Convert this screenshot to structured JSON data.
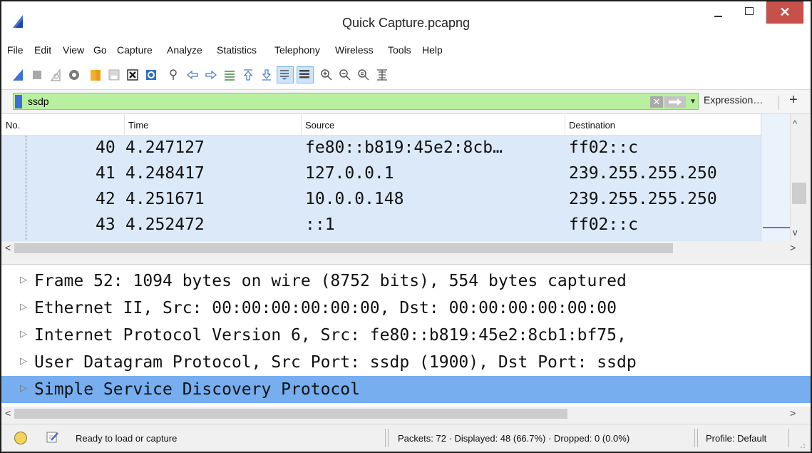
{
  "window": {
    "title": "Quick Capture.pcapng",
    "close_glyph": "✕"
  },
  "menu": [
    "File",
    "Edit",
    "View",
    "Go",
    "Capture",
    "Analyze",
    "Statistics",
    "Telephony",
    "Wireless",
    "Tools",
    "Help"
  ],
  "toolbar": {
    "icons": [
      "shark-fin-start-icon",
      "stop-icon",
      "restart-icon",
      "capture-options-icon",
      "open-file-icon",
      "save-file-icon",
      "close-file-icon",
      "reload-icon",
      "find-packet-icon",
      "go-back-icon",
      "go-forward-icon",
      "go-to-packet-icon",
      "go-first-icon",
      "go-last-icon",
      "autoscroll-icon",
      "colorize-icon",
      "zoom-in-icon",
      "zoom-out-icon",
      "zoom-normal-icon",
      "resize-columns-icon"
    ]
  },
  "filter": {
    "value": "ssdp",
    "clear_glyph": "✕",
    "dropdown_glyph": "▼",
    "expression_label": "Expression…",
    "add_label": "+",
    "color": "#b9f0a0"
  },
  "packet_list": {
    "columns": [
      "No.",
      "Time",
      "Source",
      "Destination"
    ],
    "rows": [
      {
        "no": "40",
        "time": "4.247127",
        "source": "fe80::b819:45e2:8cb…",
        "destination": "ff02::c"
      },
      {
        "no": "41",
        "time": "4.248417",
        "source": "127.0.0.1",
        "destination": "239.255.255.250"
      },
      {
        "no": "42",
        "time": "4.251671",
        "source": "10.0.0.148",
        "destination": "239.255.255.250"
      },
      {
        "no": "43",
        "time": "4.252472",
        "source": "::1",
        "destination": "ff02::c"
      }
    ],
    "row_color": "#dbe9f8",
    "scroll_up": "^",
    "scroll_down": "v",
    "scroll_left": "<",
    "scroll_right": ">"
  },
  "packet_details": {
    "expander": "▷",
    "rows": [
      "Frame 52: 1094 bytes on wire (8752 bits), 554 bytes captured",
      "Ethernet II, Src: 00:00:00:00:00:00, Dst: 00:00:00:00:00:00",
      "Internet Protocol Version 6, Src: fe80::b819:45e2:8cb1:bf75,",
      "User Datagram Protocol, Src Port: ssdp (1900), Dst Port: ssdp",
      "Simple Service Discovery Protocol"
    ],
    "selected_index": 4,
    "selected_color": "#76aef0"
  },
  "status": {
    "text": "Ready to load or capture",
    "packets": "Packets: 72 · Displayed: 48 (66.7%) · Dropped: 0 (0.0%)",
    "profile": "Profile: Default"
  }
}
